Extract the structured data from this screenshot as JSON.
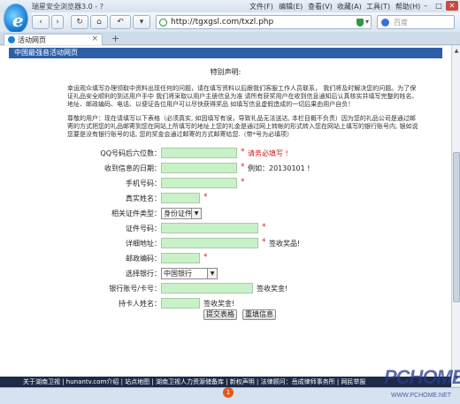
{
  "browser": {
    "title": "瑞星安全浏览器3.0 - ?",
    "menu": [
      "文件(F)",
      "编辑(E)",
      "查看(V)",
      "收藏(A)",
      "工具(T)",
      "帮助(H)"
    ],
    "url": "http://tgxgsl.com/txzl.php",
    "search_placeholder": "百度",
    "tab_title": "活动网页",
    "tab_close": "×",
    "new_tab": "+",
    "back": "‹",
    "forward": "›",
    "refresh": "↻",
    "home": "⌂",
    "undo": "↶",
    "down": "▾"
  },
  "page": {
    "header": "中国最强音活动网页",
    "notice_title": "特别声明:",
    "paragraph1": "幸运观众填写办理领取中资料出现任何的问题，请在填写资料以后跟我们客服工作人员联系，  我们将及时解决您的问题。为了保证礼品安全顺利的到达用户手中  我们将采取以用户主册信息为准 请所有获奖用户在收到信息通知后认真核实并填写完整的姓名、地址、邮政编码、电话、以便证告位用户可以尽快获得奖品  如填写信息虚假造成的一切后果由用户自负！",
    "paragraph2": "尊敬的用户：现在请填写以下表格（必须真实, 如因填写有误，导致礼品无法送达, 本栏目概不负责）因为您的礼品公司是通过邮寄的方式把您的礼品邮寄到您在网站上所填写的地址上您的礼金是通过网上转帐的形式转入您在网站上填写的银行账号内, 银如说您要是没有银行账号的话, 您的奖金会通过邮寄的方式邮寄给您.（带*号为必填项）",
    "form": {
      "rows": [
        {
          "label": "QQ号码后六位数：",
          "hint": "请务必填写 !",
          "hint_red": true,
          "star": true
        },
        {
          "label": "收到信息的日期：",
          "hint": "例如：20130101 !",
          "hint_red": false,
          "star": true
        },
        {
          "label": "手机号码：",
          "hint": "",
          "hint_red": false,
          "star": true
        },
        {
          "label": "真实姓名：",
          "hint": "",
          "hint_red": false,
          "star": true
        },
        {
          "label": "相关证件类型：",
          "select": "身份证件",
          "hint": "",
          "star": false
        },
        {
          "label": "证件号码：",
          "hint": "",
          "hint_red": false,
          "star": true
        },
        {
          "label": "详细地址：",
          "hint": "签收奖品!",
          "hint_red": false,
          "star": true
        },
        {
          "label": "邮政编码：",
          "hint": "",
          "hint_red": false,
          "star": true
        },
        {
          "label": "选择银行：",
          "select": "中国银行",
          "hint": "",
          "star": false
        },
        {
          "label": "银行账号/卡号：",
          "hint": "签收奖金!",
          "hint_red": false,
          "star": false
        },
        {
          "label": "持卡人姓名：",
          "hint": "签收奖金!",
          "hint_red": false,
          "star": false
        }
      ],
      "submit": "提交表格",
      "reset": "重填信息"
    },
    "footer": "关于湖南卫视  |  hunantv.com介绍  |  站点地图  |  湖南卫视人力资源储备库  |  新权声明  |  法律顾问：岳成律师事务所  |  网民举报"
  },
  "badge": "1",
  "watermark": {
    "main": "PCHOME",
    "sub": "WWW.PCHOME.NET"
  }
}
